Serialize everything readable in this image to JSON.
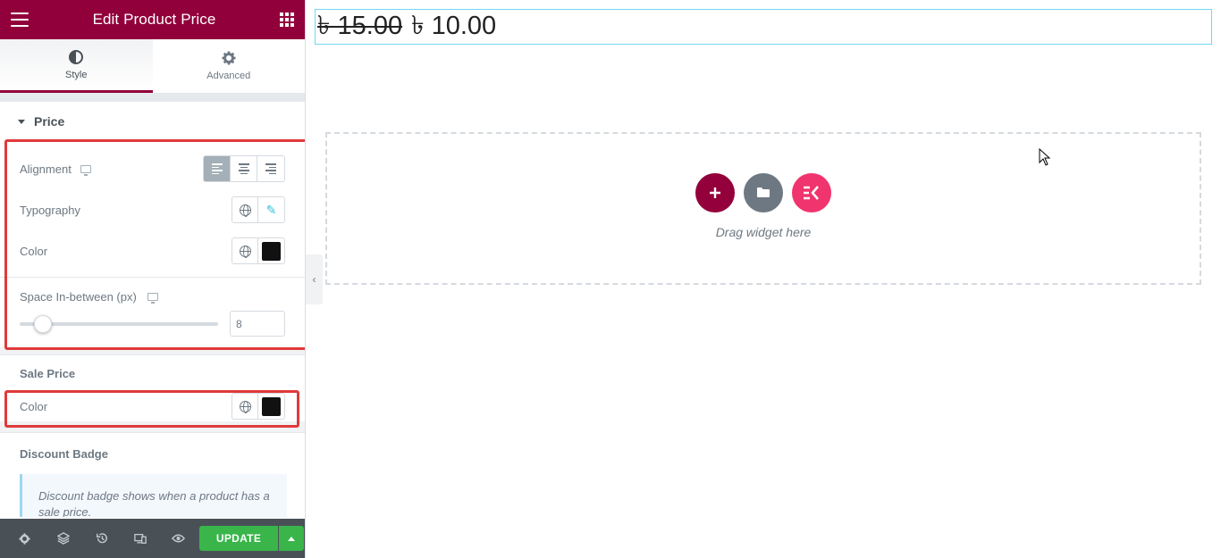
{
  "header": {
    "title": "Edit Product Price"
  },
  "tabs": [
    {
      "label": "Style",
      "icon": "contrast-icon",
      "active": true
    },
    {
      "label": "Advanced",
      "icon": "gear-icon",
      "active": false
    }
  ],
  "price_section": {
    "title": "Price",
    "alignment_label": "Alignment",
    "alignment_selected": "left",
    "typography_label": "Typography",
    "color_label": "Color",
    "color_value": "#111111",
    "space_label": "Space In-between (px)",
    "space_value": "8",
    "space_fraction": 0.08
  },
  "sale_price_section": {
    "title": "Sale Price",
    "color_label": "Color",
    "color_value": "#111111"
  },
  "discount_section": {
    "title": "Discount Badge",
    "notice": "Discount badge shows when a product has a sale price."
  },
  "footer": {
    "update_label": "UPDATE"
  },
  "canvas": {
    "old_price": "৳ 15.00",
    "new_price": "৳ 10.00",
    "drag_text": "Drag widget here"
  },
  "colors": {
    "brand": "#92003b",
    "add_button": "#93003c",
    "folder_button": "#6d7882",
    "ek_button": "#f0346e",
    "update_button": "#39b54a"
  }
}
